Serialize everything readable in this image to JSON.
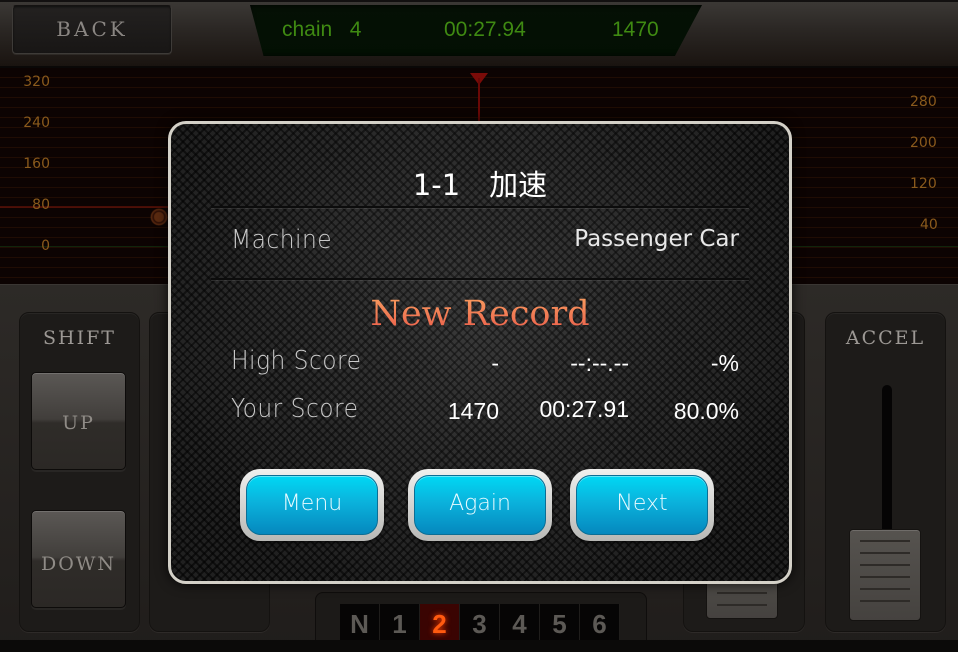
{
  "topbar": {
    "back_label": "BACK",
    "hud": {
      "chain_label": "chain   4",
      "time": "00:27.94",
      "score": "1470"
    }
  },
  "chart": {
    "left_ticks": [
      "320",
      "240",
      "160",
      "80",
      "0"
    ],
    "right_ticks": [
      "280",
      "200",
      "120",
      "40"
    ]
  },
  "controls": {
    "shift": {
      "label": "SHIFT",
      "up_label": "UP",
      "down_label": "DOWN"
    },
    "accel": {
      "label": "ACCEL",
      "level": 0.0
    },
    "gears": [
      "N",
      "1",
      "2",
      "3",
      "4",
      "5",
      "6"
    ],
    "active_gear": "2"
  },
  "modal": {
    "title": "1-1　加速",
    "machine_label": "Machine",
    "machine_value": "Passenger Car",
    "banner": "New Record",
    "high_score": {
      "label": "High Score",
      "score": "-",
      "time": "--:--.--",
      "percent": "-%"
    },
    "your_score": {
      "label": "Your Score",
      "score": "1470",
      "time": "00:27.91",
      "percent": "80.0%"
    },
    "buttons": {
      "menu": "Menu",
      "again": "Again",
      "next": "Next"
    }
  },
  "colors": {
    "hud_text": "#3f8a12",
    "tick_text": "#8a5a1c",
    "active_gear": "#ff5a10",
    "button_cyan": "#0bb2dc",
    "banner": "#f27a55"
  }
}
